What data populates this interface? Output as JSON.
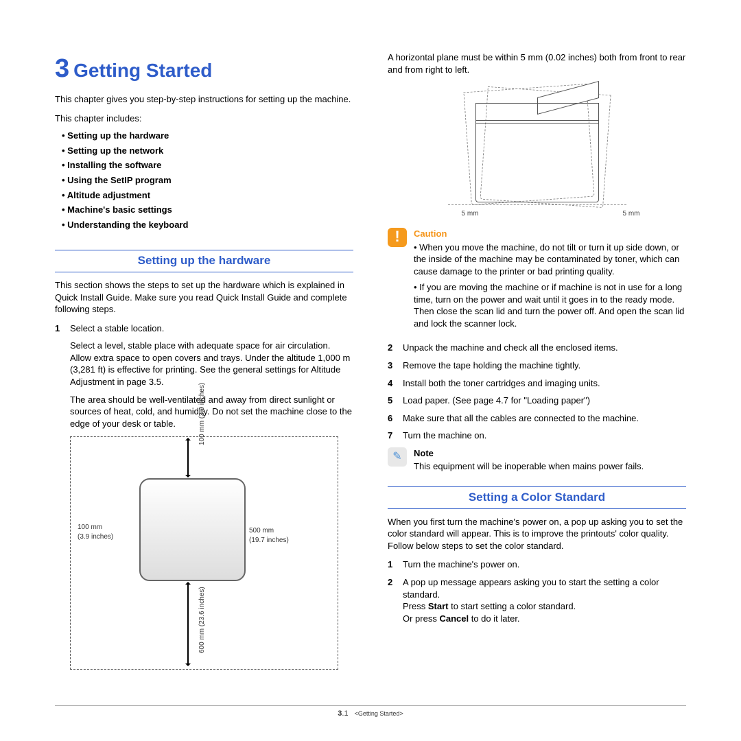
{
  "chapter": {
    "number": "3",
    "title": "Getting Started"
  },
  "intro": "This chapter gives you step-by-step instructions for setting up the machine.",
  "includes_label": "This chapter includes:",
  "toc": [
    "Setting up the hardware",
    "Setting up the network",
    "Installing the software",
    "Using the SetIP program",
    "Altitude adjustment",
    "Machine's basic settings",
    "Understanding the keyboard"
  ],
  "sec1": {
    "title": "Setting up the hardware"
  },
  "sec1_intro": "This section shows the steps to set up the hardware which is explained in Quick Install Guide. Make sure you read Quick Install Guide and complete following steps.",
  "step1_num": "1",
  "step1": "Select a stable location.",
  "step1a": "Select a level, stable place with adequate space for air circulation. Allow extra space to open covers and trays. Under the altitude 1,000 m (3,281 ft) is effective for printing. See the general settings for Altitude Adjustment in page 3.5.",
  "step1b": "The area should be well-ventilated and away from direct sunlight or sources of heat, cold, and humidity. Do not set the machine close to the edge of your desk or table.",
  "diag1": {
    "top": "100 mm\n(3.9 inches)",
    "left_mm": "100 mm",
    "left_in": "(3.9 inches)",
    "right_mm": "500 mm",
    "right_in": "(19.7 inches)",
    "bottom": "600 mm\n(23.6 inches)"
  },
  "col2_intro": "A horizontal plane must be within 5 mm (0.02 inches) both from front to rear and from right to left.",
  "diag2": {
    "mm": "5 mm"
  },
  "caution_label": "Caution",
  "caution1": "When you move the machine, do not tilt or turn it up side down, or the inside of the machine may be contaminated by toner, which can cause damage to the printer or bad printing quality.",
  "caution2": "If you are moving the machine or if machine is not in use for a long time, turn on the power and wait until it goes in to the ready mode. Then close the scan lid and turn the power off. And open the scan lid and lock the scanner lock.",
  "steps_r": [
    {
      "n": "2",
      "t": "Unpack the machine and check all the enclosed items."
    },
    {
      "n": "3",
      "t": "Remove the tape holding the machine tightly."
    },
    {
      "n": "4",
      "t": "Install both the toner cartridges and imaging units."
    },
    {
      "n": "5",
      "t": "Load paper. (See  page 4.7 for \"Loading paper\")"
    },
    {
      "n": "6",
      "t": "Make sure that all the cables are connected to the machine."
    },
    {
      "n": "7",
      "t": "Turn the machine on."
    }
  ],
  "note_label": "Note",
  "note_text": "This equipment will be inoperable when mains power fails.",
  "sec2": {
    "title": "Setting a Color Standard"
  },
  "sec2_intro": "When you first turn the machine's power on, a pop up asking you to set the color standard will appear. This is to improve the printouts' color quality. Follow below steps to set the color standard.",
  "c_step1_n": "1",
  "c_step1": "Turn the machine's power on.",
  "c_step2_n": "2",
  "c_step2a": "A pop up message appears asking you to start  the setting a color standard.",
  "c_step2b_pre": "Press ",
  "c_step2b_bold": "Start",
  "c_step2b_post": " to start setting a color standard.",
  "c_step2c_pre": "Or press ",
  "c_step2c_bold": "Cancel",
  "c_step2c_post": " to do it later.",
  "footer": {
    "page_major": "3",
    "page_minor": ".1",
    "chapter": "<Getting Started>"
  }
}
